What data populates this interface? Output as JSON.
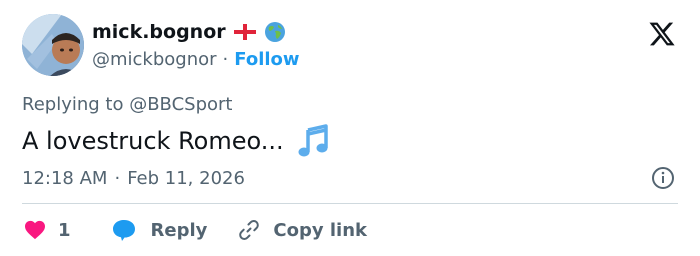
{
  "tweet": {
    "author": {
      "display_name": "mick.bognor",
      "handle": "@mickbognor",
      "separator": "·",
      "follow_label": "Follow",
      "badges": [
        "england-flag-icon",
        "globe-icon"
      ]
    },
    "replying_to_prefix": "Replying to ",
    "replying_to_handle": "@BBCSport",
    "text": "A lovestruck Romeo...",
    "text_emoji": "music-notes-icon",
    "time": "12:18 AM",
    "date_separator": "·",
    "date": "Feb 11, 2026"
  },
  "actions": {
    "like_count": "1",
    "reply_label": "Reply",
    "copy_link_label": "Copy link"
  },
  "colors": {
    "accent": "#1d9bf0",
    "text": "#0f1419",
    "muted": "#536471",
    "like": "#f91880",
    "divider": "#cfd9de"
  }
}
